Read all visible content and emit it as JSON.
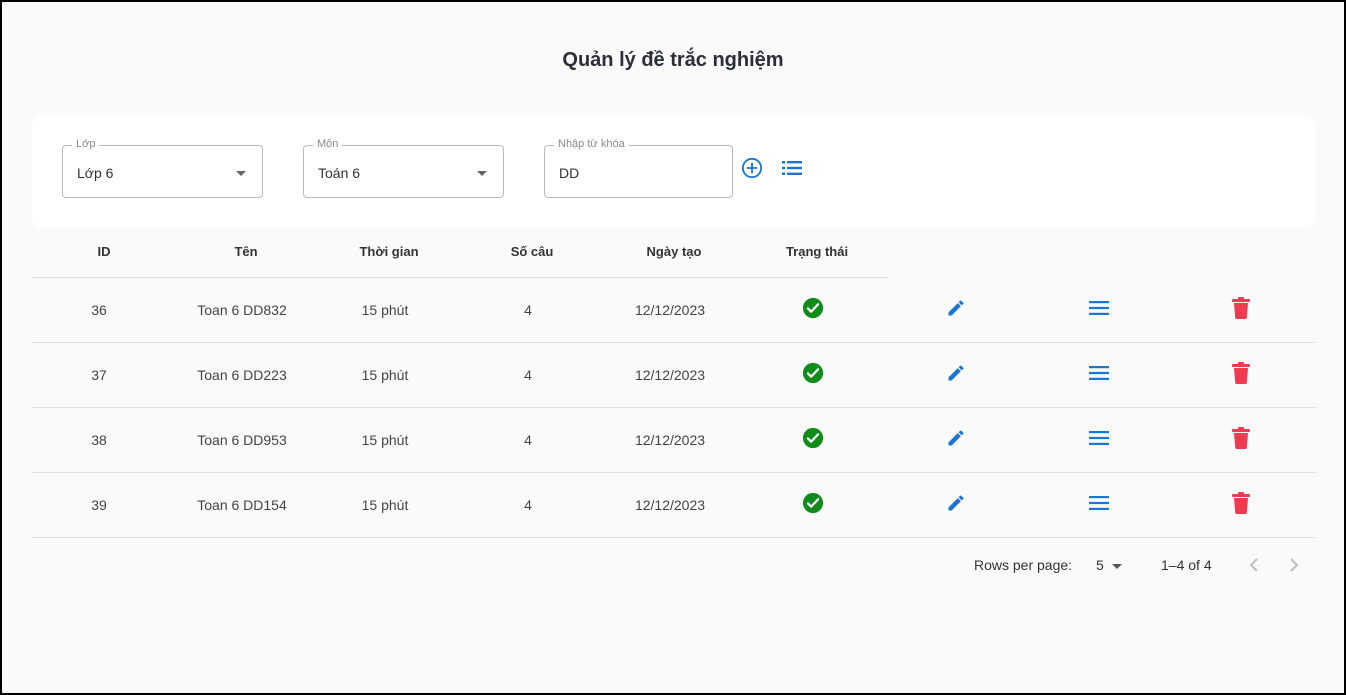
{
  "page": {
    "title": "Quản lý đề trắc nghiệm"
  },
  "filters": {
    "class": {
      "label": "Lớp",
      "value": "Lớp 6"
    },
    "subject": {
      "label": "Môn",
      "value": "Toán 6"
    },
    "keyword": {
      "label": "Nhập từ khóa",
      "value": "DD"
    },
    "add_icon": "add-circle-icon",
    "list_icon": "list-icon"
  },
  "table": {
    "headers": [
      "ID",
      "Tên",
      "Thời gian",
      "Số câu",
      "Ngày tạo",
      "Trạng thái"
    ],
    "rows": [
      {
        "id": "36",
        "name": "Toan 6 DD832",
        "duration": "15 phút",
        "questions": "4",
        "created": "12/12/2023",
        "status": "active"
      },
      {
        "id": "37",
        "name": "Toan 6 DD223",
        "duration": "15 phút",
        "questions": "4",
        "created": "12/12/2023",
        "status": "active"
      },
      {
        "id": "38",
        "name": "Toan 6 DD953",
        "duration": "15 phút",
        "questions": "4",
        "created": "12/12/2023",
        "status": "active"
      },
      {
        "id": "39",
        "name": "Toan 6 DD154",
        "duration": "15 phút",
        "questions": "4",
        "created": "12/12/2023",
        "status": "active"
      }
    ],
    "row_icons": {
      "status": "check-circle-icon",
      "edit": "edit-icon",
      "detail": "menu-icon",
      "delete": "trash-icon"
    }
  },
  "pagination": {
    "rows_per_page_label": "Rows per page:",
    "rows_per_page_value": "5",
    "range": "1–4 of 4"
  },
  "colors": {
    "accent": "#1976d2",
    "success": "#118b1a",
    "danger": "#f03a4f",
    "title": "#2b2e3b"
  }
}
